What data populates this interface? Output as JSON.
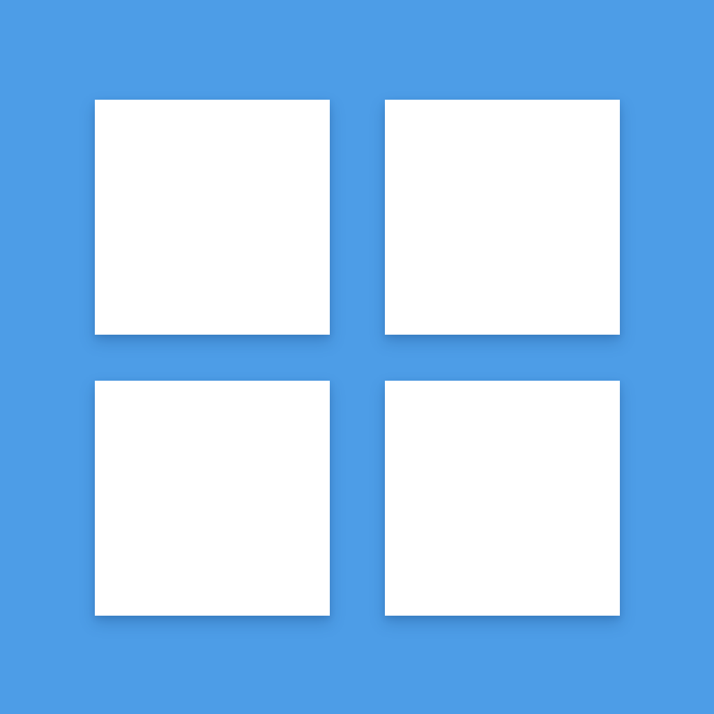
{
  "app_icon": {
    "icon": "grid-icon",
    "background_color": "#4d9de7",
    "tile_color": "#ffffff",
    "tiles": [
      {
        "id": "top-left"
      },
      {
        "id": "top-right"
      },
      {
        "id": "bottom-left"
      },
      {
        "id": "bottom-right"
      }
    ]
  }
}
